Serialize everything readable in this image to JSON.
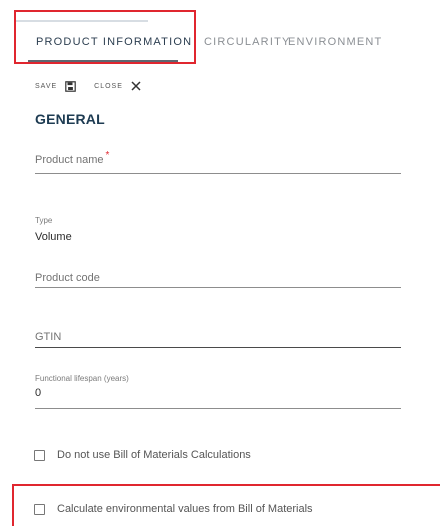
{
  "tabs": [
    {
      "label": "PRODUCT INFORMATION",
      "active": true
    },
    {
      "label": "CIRCULARITY",
      "active": false
    },
    {
      "label": "ENVIRONMENT",
      "active": false
    }
  ],
  "toolbar": {
    "save_label": "SAVE",
    "close_label": "CLOSE"
  },
  "section": {
    "title": "GENERAL"
  },
  "fields": {
    "product_name": {
      "label": "Product name",
      "required_mark": "*"
    },
    "type": {
      "label": "Type",
      "value": "Volume"
    },
    "product_code": {
      "label": "Product code"
    },
    "gtin": {
      "label": "GTIN"
    },
    "functional_lifespan": {
      "label": "Functional lifespan (years)",
      "value": "0"
    }
  },
  "checkboxes": [
    {
      "label": "Do not use Bill of Materials Calculations",
      "checked": false
    },
    {
      "label": "Calculate environmental values from Bill of Materials",
      "checked": false
    }
  ],
  "icons": {
    "save": "floppy-disk-icon",
    "close": "close-icon"
  },
  "colors": {
    "title": "#1d3b52",
    "highlight": "#e0262f",
    "tab_inactive": "#8b8f94",
    "tab_active": "#2c3e50"
  }
}
